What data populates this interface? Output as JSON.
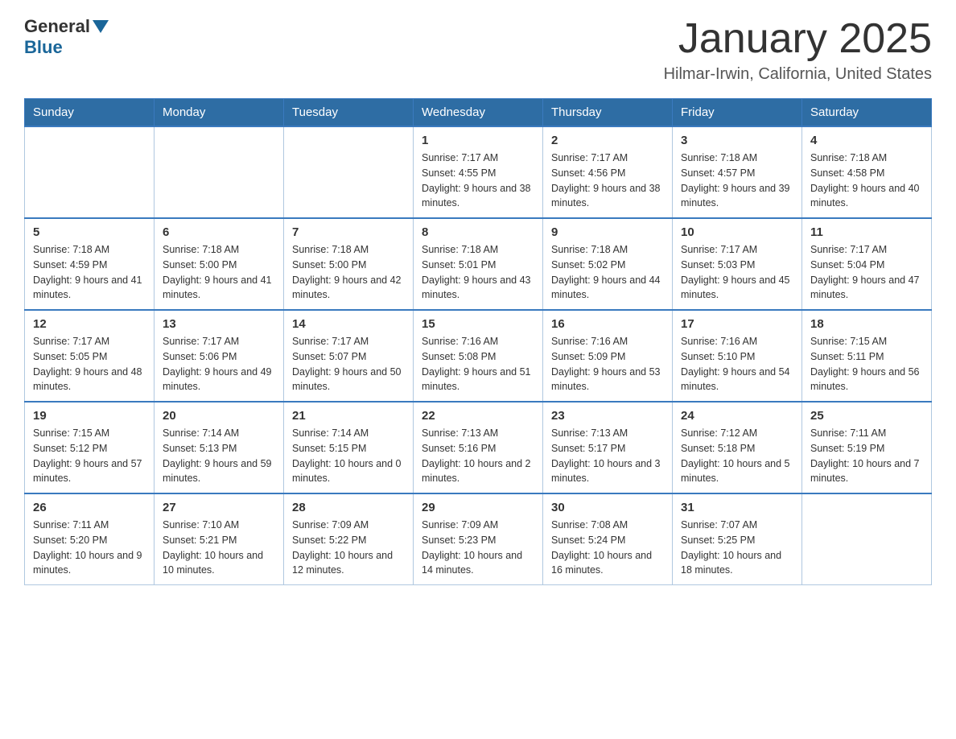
{
  "header": {
    "logo_general": "General",
    "logo_blue": "Blue",
    "month": "January 2025",
    "location": "Hilmar-Irwin, California, United States"
  },
  "days_of_week": [
    "Sunday",
    "Monday",
    "Tuesday",
    "Wednesday",
    "Thursday",
    "Friday",
    "Saturday"
  ],
  "weeks": [
    [
      {
        "day": "",
        "info": ""
      },
      {
        "day": "",
        "info": ""
      },
      {
        "day": "",
        "info": ""
      },
      {
        "day": "1",
        "info": "Sunrise: 7:17 AM\nSunset: 4:55 PM\nDaylight: 9 hours and 38 minutes."
      },
      {
        "day": "2",
        "info": "Sunrise: 7:17 AM\nSunset: 4:56 PM\nDaylight: 9 hours and 38 minutes."
      },
      {
        "day": "3",
        "info": "Sunrise: 7:18 AM\nSunset: 4:57 PM\nDaylight: 9 hours and 39 minutes."
      },
      {
        "day": "4",
        "info": "Sunrise: 7:18 AM\nSunset: 4:58 PM\nDaylight: 9 hours and 40 minutes."
      }
    ],
    [
      {
        "day": "5",
        "info": "Sunrise: 7:18 AM\nSunset: 4:59 PM\nDaylight: 9 hours and 41 minutes."
      },
      {
        "day": "6",
        "info": "Sunrise: 7:18 AM\nSunset: 5:00 PM\nDaylight: 9 hours and 41 minutes."
      },
      {
        "day": "7",
        "info": "Sunrise: 7:18 AM\nSunset: 5:00 PM\nDaylight: 9 hours and 42 minutes."
      },
      {
        "day": "8",
        "info": "Sunrise: 7:18 AM\nSunset: 5:01 PM\nDaylight: 9 hours and 43 minutes."
      },
      {
        "day": "9",
        "info": "Sunrise: 7:18 AM\nSunset: 5:02 PM\nDaylight: 9 hours and 44 minutes."
      },
      {
        "day": "10",
        "info": "Sunrise: 7:17 AM\nSunset: 5:03 PM\nDaylight: 9 hours and 45 minutes."
      },
      {
        "day": "11",
        "info": "Sunrise: 7:17 AM\nSunset: 5:04 PM\nDaylight: 9 hours and 47 minutes."
      }
    ],
    [
      {
        "day": "12",
        "info": "Sunrise: 7:17 AM\nSunset: 5:05 PM\nDaylight: 9 hours and 48 minutes."
      },
      {
        "day": "13",
        "info": "Sunrise: 7:17 AM\nSunset: 5:06 PM\nDaylight: 9 hours and 49 minutes."
      },
      {
        "day": "14",
        "info": "Sunrise: 7:17 AM\nSunset: 5:07 PM\nDaylight: 9 hours and 50 minutes."
      },
      {
        "day": "15",
        "info": "Sunrise: 7:16 AM\nSunset: 5:08 PM\nDaylight: 9 hours and 51 minutes."
      },
      {
        "day": "16",
        "info": "Sunrise: 7:16 AM\nSunset: 5:09 PM\nDaylight: 9 hours and 53 minutes."
      },
      {
        "day": "17",
        "info": "Sunrise: 7:16 AM\nSunset: 5:10 PM\nDaylight: 9 hours and 54 minutes."
      },
      {
        "day": "18",
        "info": "Sunrise: 7:15 AM\nSunset: 5:11 PM\nDaylight: 9 hours and 56 minutes."
      }
    ],
    [
      {
        "day": "19",
        "info": "Sunrise: 7:15 AM\nSunset: 5:12 PM\nDaylight: 9 hours and 57 minutes."
      },
      {
        "day": "20",
        "info": "Sunrise: 7:14 AM\nSunset: 5:13 PM\nDaylight: 9 hours and 59 minutes."
      },
      {
        "day": "21",
        "info": "Sunrise: 7:14 AM\nSunset: 5:15 PM\nDaylight: 10 hours and 0 minutes."
      },
      {
        "day": "22",
        "info": "Sunrise: 7:13 AM\nSunset: 5:16 PM\nDaylight: 10 hours and 2 minutes."
      },
      {
        "day": "23",
        "info": "Sunrise: 7:13 AM\nSunset: 5:17 PM\nDaylight: 10 hours and 3 minutes."
      },
      {
        "day": "24",
        "info": "Sunrise: 7:12 AM\nSunset: 5:18 PM\nDaylight: 10 hours and 5 minutes."
      },
      {
        "day": "25",
        "info": "Sunrise: 7:11 AM\nSunset: 5:19 PM\nDaylight: 10 hours and 7 minutes."
      }
    ],
    [
      {
        "day": "26",
        "info": "Sunrise: 7:11 AM\nSunset: 5:20 PM\nDaylight: 10 hours and 9 minutes."
      },
      {
        "day": "27",
        "info": "Sunrise: 7:10 AM\nSunset: 5:21 PM\nDaylight: 10 hours and 10 minutes."
      },
      {
        "day": "28",
        "info": "Sunrise: 7:09 AM\nSunset: 5:22 PM\nDaylight: 10 hours and 12 minutes."
      },
      {
        "day": "29",
        "info": "Sunrise: 7:09 AM\nSunset: 5:23 PM\nDaylight: 10 hours and 14 minutes."
      },
      {
        "day": "30",
        "info": "Sunrise: 7:08 AM\nSunset: 5:24 PM\nDaylight: 10 hours and 16 minutes."
      },
      {
        "day": "31",
        "info": "Sunrise: 7:07 AM\nSunset: 5:25 PM\nDaylight: 10 hours and 18 minutes."
      },
      {
        "day": "",
        "info": ""
      }
    ]
  ]
}
